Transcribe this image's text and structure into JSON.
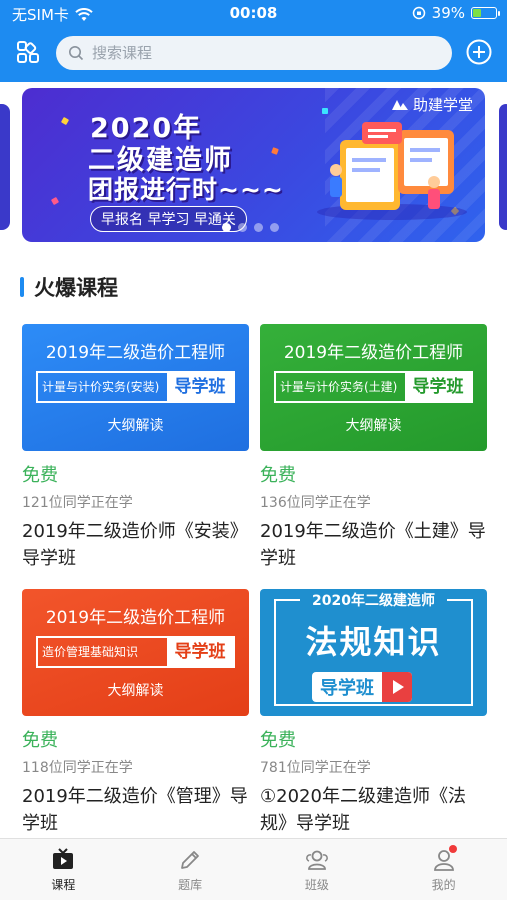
{
  "status_bar": {
    "carrier": "无SIM卡",
    "time": "00:08",
    "battery": "39%",
    "battery_level": 0.39
  },
  "header": {
    "search_placeholder": "搜索课程"
  },
  "banner": {
    "brand": "助建学堂",
    "line1": "2020年",
    "line2": "二级建造师",
    "line3": "团报进行时~~~",
    "tags": "早报名 早学习 早通关",
    "slide_count": 4,
    "active_slide": 1
  },
  "section": {
    "title": "火爆课程"
  },
  "courses": [
    {
      "thumb_title": "2019年二级造价工程师",
      "thumb_sub": "计量与计价实务(安装)",
      "thumb_label": "导学班",
      "thumb_foot": "大纲解读",
      "price": "免费",
      "learners": "121位同学正在学",
      "title": "2019年二级造价师《安装》导学班"
    },
    {
      "thumb_title": "2019年二级造价工程师",
      "thumb_sub": "计量与计价实务(土建)",
      "thumb_label": "导学班",
      "thumb_foot": "大纲解读",
      "price": "免费",
      "learners": "136位同学正在学",
      "title": "2019年二级造价《土建》导学班"
    },
    {
      "thumb_title": "2019年二级造价工程师",
      "thumb_sub": "造价管理基础知识",
      "thumb_label": "导学班",
      "thumb_foot": "大纲解读",
      "price": "免费",
      "learners": "118位同学正在学",
      "title": "2019年二级造价《管理》导学班"
    },
    {
      "thumb_title": "2020年二级建造师",
      "thumb_big": "法规知识",
      "thumb_label": "导学班",
      "price": "免费",
      "learners": "781位同学正在学",
      "title": "①2020年二级建造师《法规》导学班"
    }
  ],
  "tabbar": {
    "items": [
      {
        "label": "课程",
        "icon": "play-tv-icon",
        "active": true
      },
      {
        "label": "题库",
        "icon": "pencil-icon",
        "active": false
      },
      {
        "label": "班级",
        "icon": "group-icon",
        "active": false
      },
      {
        "label": "我的",
        "icon": "user-icon",
        "active": false,
        "badge": true
      }
    ]
  },
  "colors": {
    "primary": "#1d8bf1",
    "price_green": "#3bb25a"
  }
}
